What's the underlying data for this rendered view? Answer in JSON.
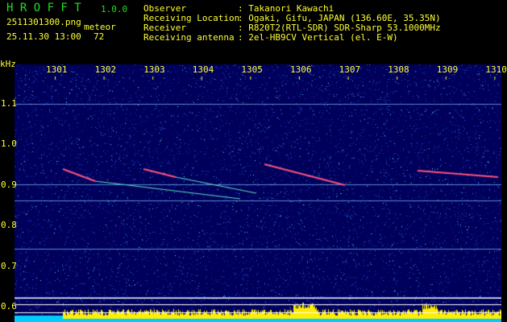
{
  "header": {
    "app_name": "H R O F F T",
    "version": "1.0.0",
    "filename": "2511301300.png",
    "datetime": "25.11.30 13:00",
    "count_label": "meteor",
    "count": "72",
    "info": [
      {
        "label": "Observer",
        "value": ": Takanori Kawachi"
      },
      {
        "label": "Receiving Location",
        "value": ": Ogaki, Gifu, JAPAN (136.60E, 35.35N)"
      },
      {
        "label": "Receiver",
        "value": ": R820T2(RTL-SDR) SDR-Sharp 53.1000MHz"
      },
      {
        "label": "Receiving antenna",
        "value": ": 2el-HB9CV Vertical (el. E-W)"
      }
    ]
  },
  "chart_data": {
    "type": "heatmap",
    "ylabel": "kHz",
    "x_ticks": [
      "1301",
      "1302",
      "1303",
      "1304",
      "1305",
      "1306",
      "1307",
      "1308",
      "1309",
      "1310"
    ],
    "y_ticks": [
      "1.1",
      "1.0",
      "0.9",
      "0.8",
      "0.7",
      "0.6"
    ],
    "ylim": [
      0.58,
      1.22
    ],
    "carrier_lines_khz": [
      1.12,
      0.92,
      0.88,
      0.76,
      0.64
    ],
    "colors": {
      "background": "#000066",
      "text": "#ffff33",
      "histogram": "#ffee00",
      "base": "#00ccff"
    }
  }
}
